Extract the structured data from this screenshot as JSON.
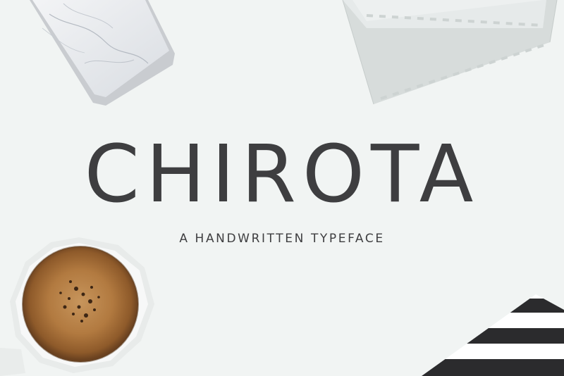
{
  "poster": {
    "title": "CHIROTA",
    "subtitle": "A HANDWRITTEN TYPEFACE"
  },
  "colors": {
    "background": "#f1f4f3",
    "text": "#3e3e40",
    "coffee": "#a8753f",
    "stripes": "#2b2b2d"
  },
  "props": [
    "marble-phone",
    "envelope",
    "coffee-cup",
    "striped-paper"
  ]
}
